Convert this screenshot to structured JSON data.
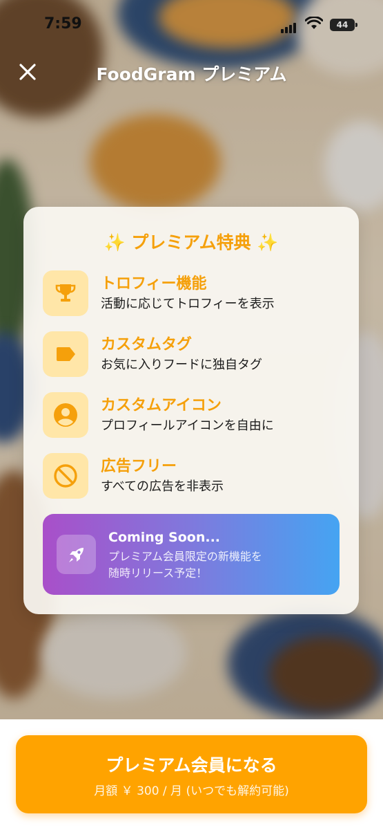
{
  "status_bar": {
    "time": "7:59",
    "battery": "44"
  },
  "header": {
    "title": "FoodGram プレミアム"
  },
  "card": {
    "heading": "✨ プレミアム特典 ✨",
    "features": [
      {
        "title": "トロフィー機能",
        "description": "活動に応じてトロフィーを表示",
        "icon": "trophy-icon"
      },
      {
        "title": "カスタムタグ",
        "description": "お気に入りフードに独自タグ",
        "icon": "tag-icon"
      },
      {
        "title": "カスタムアイコン",
        "description": "プロフィールアイコンを自由に",
        "icon": "account-circle-icon"
      },
      {
        "title": "広告フリー",
        "description": "すべての広告を非表示",
        "icon": "no-ads-icon"
      }
    ],
    "coming_soon": {
      "title": "Coming Soon...",
      "description": "プレミアム会員限定の新機能を\n随時リリース予定！",
      "icon": "rocket-icon"
    }
  },
  "cta": {
    "label": "プレミアム会員になる",
    "sublabel": "月額 ￥ 300 / 月 (いつでも解約可能)"
  },
  "colors": {
    "accent": "#f5a00b",
    "icon_bg": "#ffe6a8",
    "cta": "#ffa300",
    "gradient_start": "#a94fc9",
    "gradient_end": "#45a4f2"
  }
}
